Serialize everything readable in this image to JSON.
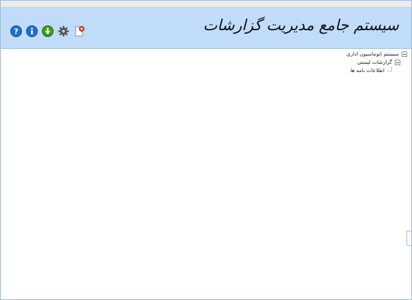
{
  "header": {
    "title": "سیستم جامع مدیریت گزارشات",
    "toolbar": {
      "items": [
        {
          "name": "help",
          "icon": "help-icon",
          "color": "#1e6fc8"
        },
        {
          "name": "info",
          "icon": "info-icon",
          "color": "#1e6fc8"
        },
        {
          "name": "download",
          "icon": "download-icon",
          "color": "#3a9d23"
        },
        {
          "name": "settings",
          "icon": "gear-icon",
          "color": "#555555"
        },
        {
          "name": "exit",
          "icon": "document-close-icon",
          "color": "#d6382f"
        }
      ]
    }
  },
  "tree": {
    "root": {
      "label": "سیستم اتوماسیون اداری",
      "expanded": true
    },
    "child": {
      "label": "گزارشات لیستی",
      "expanded": true
    },
    "leaf": {
      "label": "اطلاعات نامه ها"
    }
  },
  "colors": {
    "header_bg": "#c0dcf9",
    "border": "#9fb7d3"
  }
}
